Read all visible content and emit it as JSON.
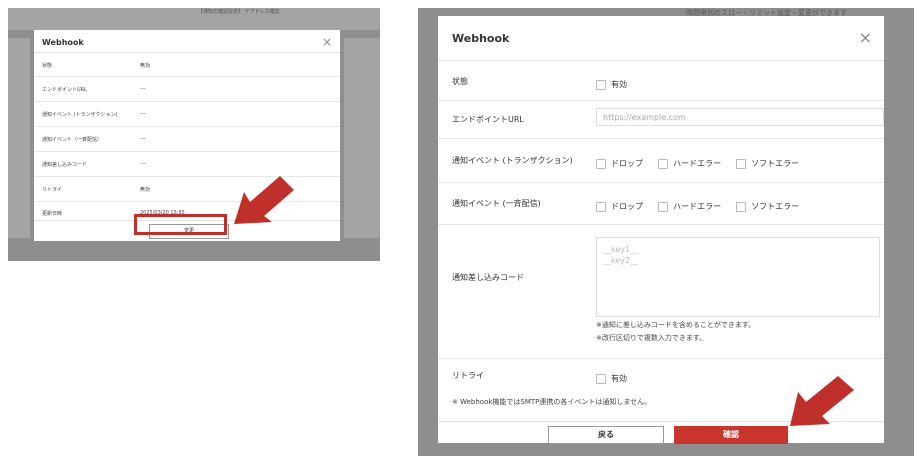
{
  "colors": {
    "accent": "#c9352d",
    "overlay": "#8e8e8e"
  },
  "left": {
    "bg_text": "【通知の確認設定】 テアドレス確認",
    "title": "Webhook",
    "close_icon": "×",
    "rows": [
      {
        "label": "状態",
        "value": "無効"
      },
      {
        "label": "エンドポイントURL",
        "value": "---"
      },
      {
        "label": "通知イベント (トランザクション)",
        "value": "---"
      },
      {
        "label": "通知イベント（一斉配信）",
        "value": "---"
      },
      {
        "label": "通知差し込みコード",
        "value": "---"
      },
      {
        "label": "リトライ",
        "value": "無効"
      },
      {
        "label": "更新日時",
        "value": "2025/03/20 15:55"
      }
    ],
    "edit_label": "変更"
  },
  "right": {
    "bg_text": "時間帯別のスロー・リミット設定・変更ができます",
    "title": "Webhook",
    "close_icon": "×",
    "status_label": "状態",
    "status_option": "有効",
    "endpoint_label": "エンドポイントURL",
    "endpoint_placeholder": "https://example.com",
    "trans_label": "通知イベント (トランザクション)",
    "bulk_label": "通知イベント (一斉配信)",
    "events": [
      "ドロップ",
      "ハードエラー",
      "ソフトエラー"
    ],
    "code_label": "通知差し込みコード",
    "code_placeholder_1": "__key1__",
    "code_placeholder_2": "__key2__",
    "help_1": "※通知に差し込みコードを含めることができます。",
    "help_2": "※改行区切りで複数入力できます。",
    "retry_label": "リトライ",
    "retry_option": "有効",
    "note": "※ Webhook機能ではSMTP連携の各イベントは通知しません。",
    "back_label": "戻る",
    "confirm_label": "確認"
  }
}
